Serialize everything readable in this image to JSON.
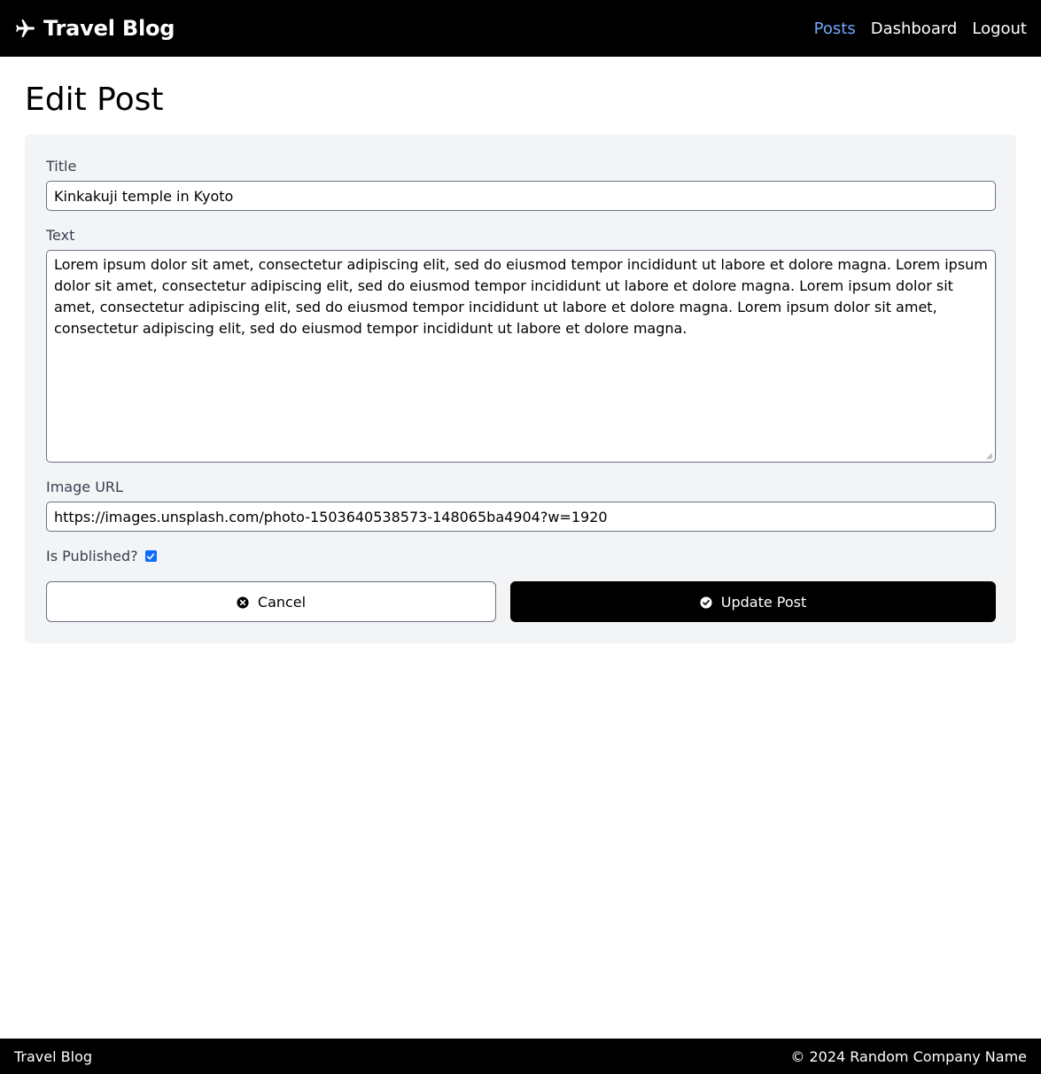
{
  "navbar": {
    "brand": "Travel Blog",
    "brand_icon": "plane-icon",
    "links": [
      {
        "label": "Posts",
        "active": true
      },
      {
        "label": "Dashboard",
        "active": false
      },
      {
        "label": "Logout",
        "active": false
      }
    ]
  },
  "page": {
    "title": "Edit Post"
  },
  "form": {
    "title_label": "Title",
    "title_value": "Kinkakuji temple in Kyoto",
    "text_label": "Text",
    "text_value": "Lorem ipsum dolor sit amet, consectetur adipiscing elit, sed do eiusmod tempor incididunt ut labore et dolore magna. Lorem ipsum dolor sit amet, consectetur adipiscing elit, sed do eiusmod tempor incididunt ut labore et dolore magna. Lorem ipsum dolor sit amet, consectetur adipiscing elit, sed do eiusmod tempor incididunt ut labore et dolore magna. Lorem ipsum dolor sit amet, consectetur adipiscing elit, sed do eiusmod tempor incididunt ut labore et dolore magna.",
    "image_url_label": "Image URL",
    "image_url_value": "https://images.unsplash.com/photo-1503640538573-148065ba4904?w=1920",
    "published_label": "Is Published?",
    "published": true,
    "cancel_label": "Cancel",
    "cancel_icon": "circle-x-icon",
    "update_label": "Update Post",
    "update_icon": "circle-check-icon"
  },
  "footer": {
    "brand": "Travel Blog",
    "copyright": "© 2024 Random Company Name"
  },
  "colors": {
    "navbar_bg": "#000000",
    "active_link": "#6ea8fe",
    "card_bg": "#f3f4f6",
    "checkbox": "#0d6efd"
  }
}
